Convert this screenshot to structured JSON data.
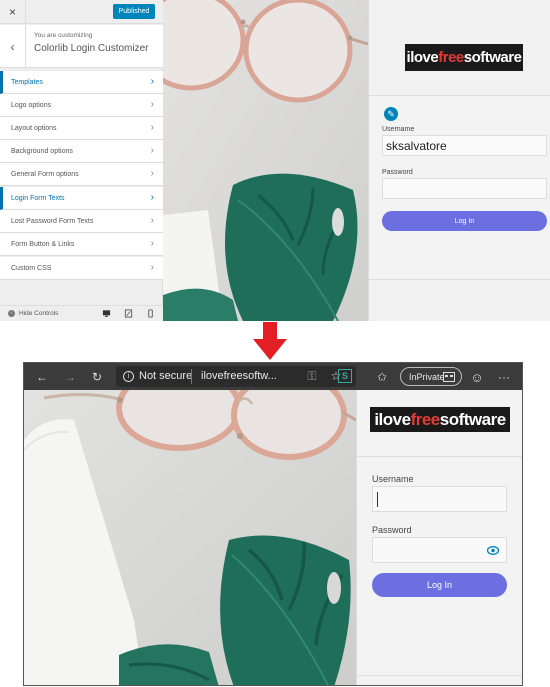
{
  "customizer": {
    "close_icon": "×",
    "publish_label": "Published",
    "back_icon": "‹",
    "you_are_customizing": "You are customizing",
    "title": "Colorlib Login Customizer",
    "items": [
      {
        "label": "Templates",
        "active": true
      },
      {
        "label": "Logo options",
        "active": false
      },
      {
        "label": "Layout options",
        "active": false
      },
      {
        "label": "Background options",
        "active": false
      },
      {
        "label": "General Form options",
        "active": false
      },
      {
        "label": "Login Form Texts",
        "active": true
      },
      {
        "label": "Lost Password Form Texts",
        "active": false
      },
      {
        "label": "Form Button & Links",
        "active": false
      },
      {
        "label": "Custom CSS",
        "active": false
      }
    ],
    "chevron": "›",
    "hide_controls": "Hide Controls",
    "hide_icon": "‹"
  },
  "preview_top": {
    "logo_prefix": "ilove",
    "logo_highlight": "free",
    "logo_suffix": "software",
    "username_label": "Username",
    "username_value": "sksalvatore",
    "password_label": "Password",
    "login_button": "Log In",
    "edit_icon": "✎"
  },
  "browser": {
    "back_icon": "←",
    "forward_icon": "→",
    "refresh_icon": "↻",
    "info_icon": "i",
    "not_secure": "Not secure",
    "url": "ilovefreesoftw...",
    "key_icon": "⚿",
    "star_icon": "☆",
    "extension_icon": "S",
    "favorites_icon": "✩",
    "inprivate": "InPrivate",
    "emoji_icon": "☺",
    "more_icon": "···"
  },
  "preview_bottom": {
    "logo_prefix": "ilove",
    "logo_highlight": "free",
    "logo_suffix": "software",
    "username_label": "Username",
    "password_label": "Password",
    "login_button": "Log In",
    "eye_icon": "👁"
  },
  "colors": {
    "accent_blue": "#0073aa",
    "publish_blue": "#0085ba",
    "login_button": "#6b6fe0",
    "arrow_red": "#e31e24",
    "leaf_green": "#1e6e5a",
    "browser_toolbar": "#3b3b3b"
  }
}
